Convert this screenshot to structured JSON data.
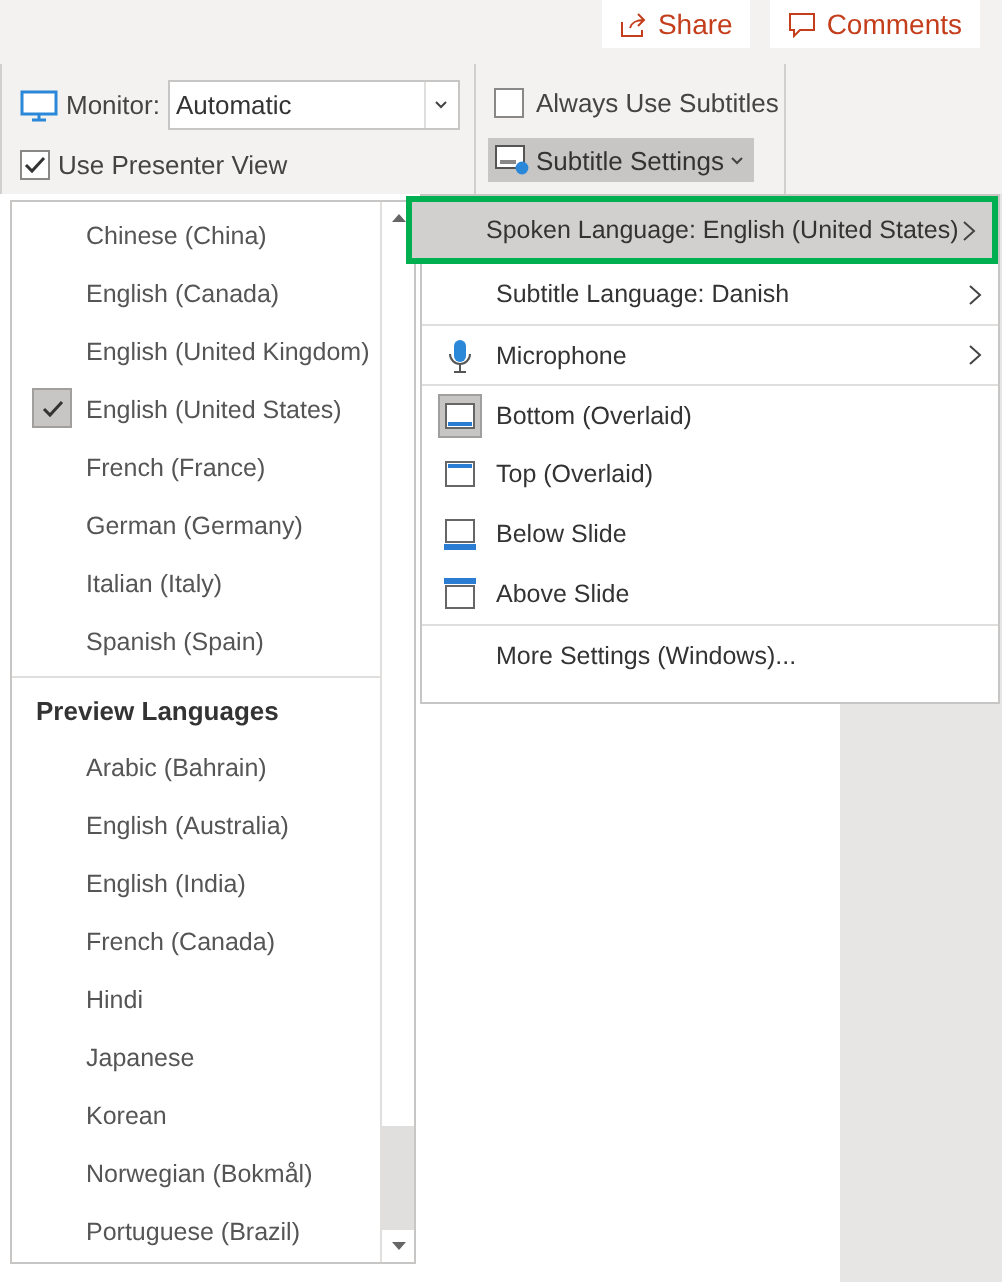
{
  "ribbon": {
    "share": "Share",
    "comments": "Comments",
    "monitor": {
      "label": "Monitor:",
      "value": "Automatic"
    },
    "use_presenter_view": {
      "label": "Use Presenter View",
      "checked": true
    },
    "always_use_subtitles": {
      "label": "Always Use Subtitles",
      "checked": false
    },
    "subtitle_settings": {
      "label": "Subtitle Settings",
      "expanded": true
    }
  },
  "language_list": {
    "items": [
      {
        "label": "Chinese (China)",
        "selected": false
      },
      {
        "label": "English (Canada)",
        "selected": false
      },
      {
        "label": "English (United Kingdom)",
        "selected": false
      },
      {
        "label": "English (United States)",
        "selected": true
      },
      {
        "label": "French (France)",
        "selected": false
      },
      {
        "label": "German (Germany)",
        "selected": false
      },
      {
        "label": "Italian (Italy)",
        "selected": false
      },
      {
        "label": "Spanish (Spain)",
        "selected": false
      }
    ],
    "preview_header": "Preview Languages",
    "preview_items": [
      {
        "label": "Arabic (Bahrain)",
        "selected": false
      },
      {
        "label": "English (Australia)",
        "selected": false
      },
      {
        "label": "English (India)",
        "selected": false
      },
      {
        "label": "French (Canada)",
        "selected": false
      },
      {
        "label": "Hindi",
        "selected": false
      },
      {
        "label": "Japanese",
        "selected": false
      },
      {
        "label": "Korean",
        "selected": false
      },
      {
        "label": "Norwegian (Bokmål)",
        "selected": false
      },
      {
        "label": "Portuguese (Brazil)",
        "selected": false
      }
    ]
  },
  "subtitle_menu": {
    "items": [
      {
        "kind": "submenu",
        "label": "Spoken Language: English (United States)",
        "highlighted": true
      },
      {
        "kind": "submenu",
        "label": "Subtitle Language: Danish",
        "highlighted": false
      },
      {
        "kind": "microphone",
        "label": "Microphone",
        "highlighted": false
      },
      {
        "kind": "bottom",
        "label": "Bottom (Overlaid)",
        "selected": true
      },
      {
        "kind": "top",
        "label": "Top (Overlaid)",
        "selected": false
      },
      {
        "kind": "below",
        "label": "Below Slide",
        "selected": false
      },
      {
        "kind": "above",
        "label": "Above Slide",
        "selected": false
      },
      {
        "kind": "command",
        "label": "More Settings (Windows)..."
      }
    ]
  }
}
